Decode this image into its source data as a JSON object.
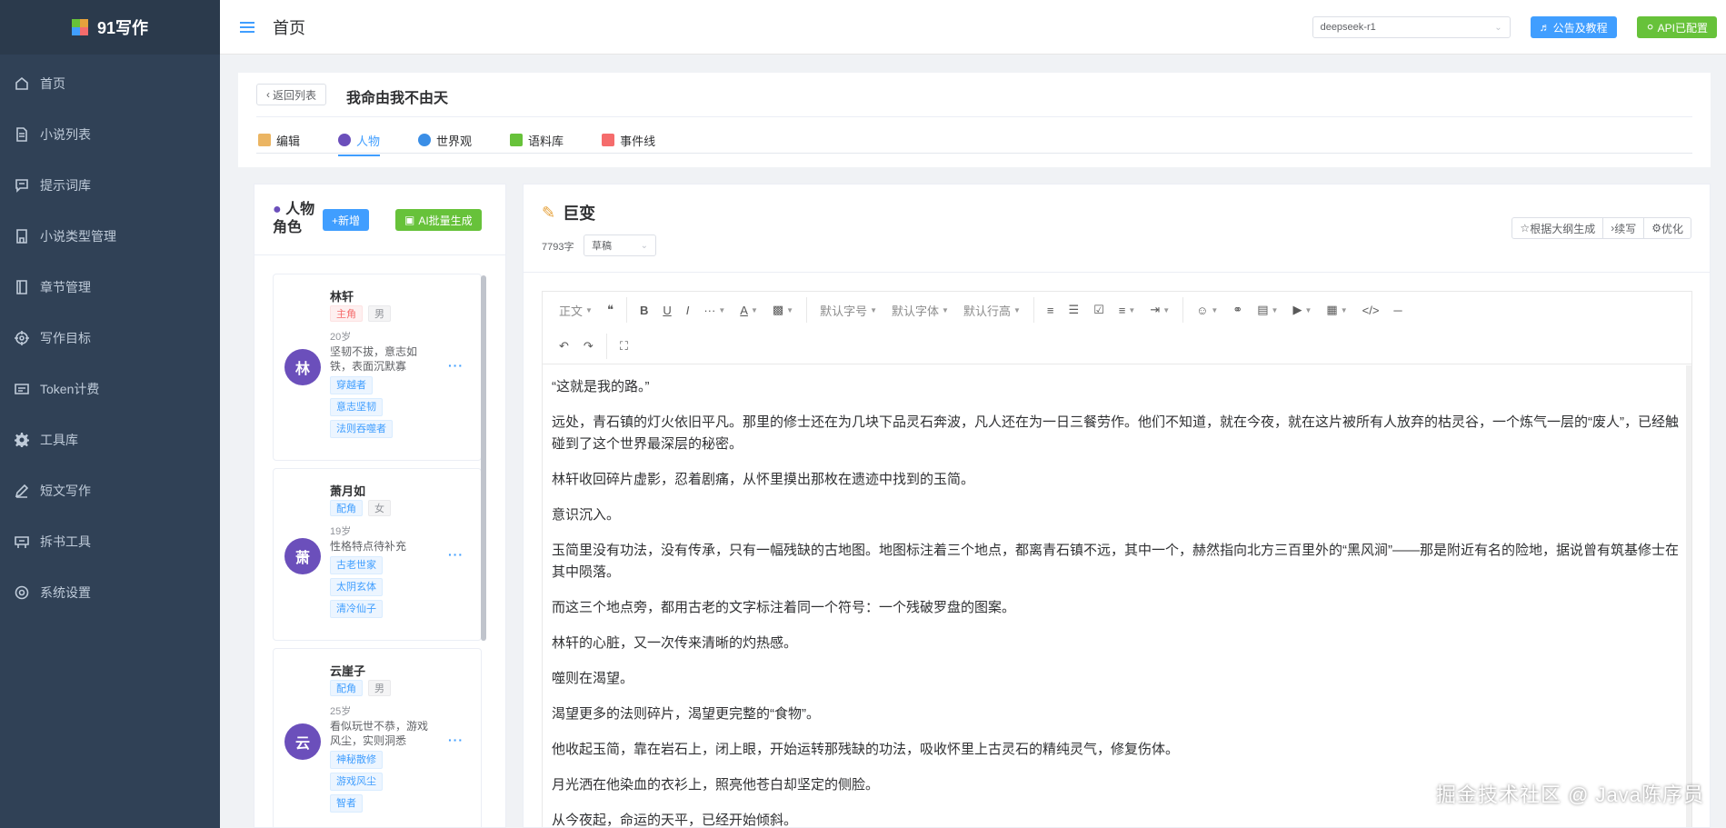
{
  "app": {
    "name": "91写作"
  },
  "sidebar": {
    "items": [
      {
        "label": "首页",
        "icon": "home-icon"
      },
      {
        "label": "小说列表",
        "icon": "document-icon"
      },
      {
        "label": "提示词库",
        "icon": "message-icon"
      },
      {
        "label": "小说类型管理",
        "icon": "folder-icon"
      },
      {
        "label": "章节管理",
        "icon": "book-icon"
      },
      {
        "label": "写作目标",
        "icon": "target-icon"
      },
      {
        "label": "Token计费",
        "icon": "wallet-icon"
      },
      {
        "label": "工具库",
        "icon": "gear-icon"
      },
      {
        "label": "短文写作",
        "icon": "pen-icon"
      },
      {
        "label": "拆书工具",
        "icon": "split-icon"
      },
      {
        "label": "系统设置",
        "icon": "settings-icon"
      }
    ]
  },
  "header": {
    "breadcrumb": "首页",
    "model": "deepseek-r1",
    "notice_button": "公告及教程",
    "api_button": "API已配置"
  },
  "novel": {
    "back_button": "返回列表",
    "title": "我命由我不由天",
    "tabs": [
      {
        "label": "编辑",
        "icon": "edit-icon",
        "color": "#e6a23c"
      },
      {
        "label": "人物",
        "icon": "people-icon",
        "color": "#6b4fbb"
      },
      {
        "label": "世界观",
        "icon": "globe-icon",
        "color": "#3a8ee6"
      },
      {
        "label": "语料库",
        "icon": "books-icon",
        "color": "#67c23a"
      },
      {
        "label": "事件线",
        "icon": "chart-icon",
        "color": "#f56c6c"
      }
    ],
    "active_tab": "人物"
  },
  "characters": {
    "title": "人物角色",
    "add_button": "+新增",
    "ai_button": "AI批量生成",
    "list": [
      {
        "avatar": "林",
        "name": "林轩",
        "role": "主角",
        "gender": "男",
        "age": "20岁",
        "desc": "坚韧不拔，意志如铁，表面沉默寡",
        "keywords": [
          "穿越者",
          "意志坚韧",
          "法则吞噬者"
        ]
      },
      {
        "avatar": "萧",
        "name": "萧月如",
        "role": "配角",
        "gender": "女",
        "age": "19岁",
        "desc": "性格特点待补充",
        "keywords": [
          "古老世家",
          "太阴玄体",
          "清冷仙子"
        ]
      },
      {
        "avatar": "云",
        "name": "云崖子",
        "role": "配角",
        "gender": "男",
        "age": "25岁",
        "desc": "看似玩世不恭，游戏风尘，实则洞悉",
        "keywords": [
          "神秘散修",
          "游戏风尘",
          "智者"
        ]
      }
    ],
    "more": "···"
  },
  "chapter": {
    "title": "巨变",
    "word_count": "7793字",
    "status": "草稿",
    "actions": [
      "根据大纲生成",
      "续写",
      "优化"
    ]
  },
  "toolbar": {
    "paragraph": "正文",
    "font_size": "默认字号",
    "font_family": "默认字体",
    "line_height": "默认行高"
  },
  "content": {
    "paragraphs": [
      "“这就是我的路。”",
      "远处，青石镇的灯火依旧平凡。那里的修士还在为几块下品灵石奔波，凡人还在为一日三餐劳作。他们不知道，就在今夜，就在这片被所有人放弃的枯灵谷，一个炼气一层的“废人”，已经触碰到了这个世界最深层的秘密。",
      "林轩收回碎片虚影，忍着剧痛，从怀里摸出那枚在遗迹中找到的玉简。",
      "意识沉入。",
      "玉简里没有功法，没有传承，只有一幅残缺的古地图。地图标注着三个地点，都离青石镇不远，其中一个，赫然指向北方三百里外的“黑风涧”——那是附近有名的险地，据说曾有筑基修士在其中陨落。",
      "而这三个地点旁，都用古老的文字标注着同一个符号：一个残破罗盘的图案。",
      "林轩的心脏，又一次传来清晰的灼热感。",
      "噬则在渴望。",
      "渴望更多的法则碎片，渴望更完整的“食物”。",
      "他收起玉简，靠在岩石上，闭上眼，开始运转那残缺的功法，吸收怀里上古灵石的精纯灵气，修复伤体。",
      "月光洒在他染血的衣衫上，照亮他苍白却坚定的侧脸。",
      "从今夜起，命运的天平，已经开始倾斜。"
    ]
  },
  "watermark": "掘金技术社区 @ Java陈序员"
}
